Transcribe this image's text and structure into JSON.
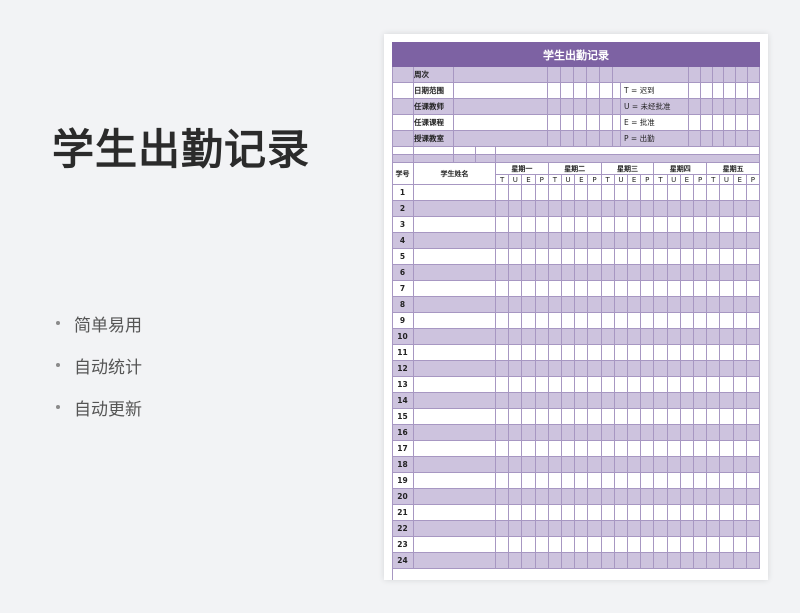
{
  "slide": {
    "title": "学生出勤记录",
    "features": [
      "简单易用",
      "自动统计",
      "自动更新"
    ]
  },
  "sheet": {
    "title": "学生出勤记录",
    "info_labels": [
      "周次",
      "日期范围",
      "任课教师",
      "任课课程",
      "授课教室"
    ],
    "legend": [
      "T = 迟到",
      "U = 未经批准",
      "E = 批准",
      "P = 出勤"
    ],
    "col_student_id": "学号",
    "col_student_name": "学生姓名",
    "days": [
      "星期一",
      "星期二",
      "星期三",
      "星期四",
      "星期五"
    ],
    "status_codes": [
      "T",
      "U",
      "E",
      "P"
    ],
    "row_numbers": [
      "1",
      "2",
      "3",
      "4",
      "5",
      "6",
      "7",
      "8",
      "9",
      "10",
      "11",
      "12",
      "13",
      "14",
      "15",
      "16",
      "17",
      "18",
      "19",
      "20",
      "21",
      "22",
      "23",
      "24"
    ]
  },
  "colors": {
    "accent": "#7d62a3",
    "band": "#cdc3de",
    "grid_line": "#a797c2"
  }
}
